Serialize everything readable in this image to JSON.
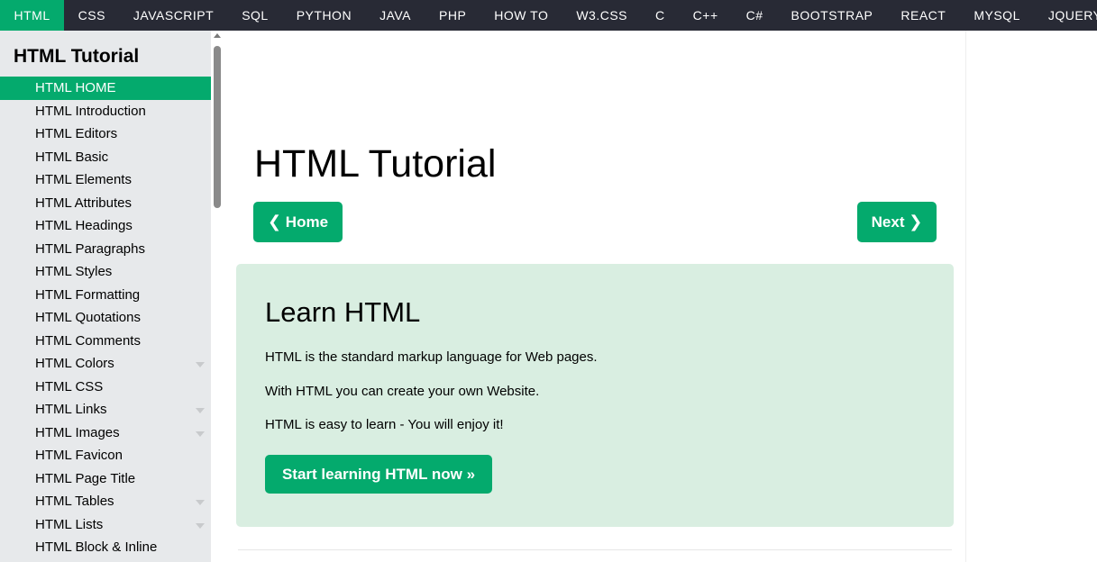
{
  "topnav": {
    "items": [
      "HTML",
      "CSS",
      "JAVASCRIPT",
      "SQL",
      "PYTHON",
      "JAVA",
      "PHP",
      "HOW TO",
      "W3.CSS",
      "C",
      "C++",
      "C#",
      "BOOTSTRAP",
      "REACT",
      "MYSQL",
      "JQUERY"
    ],
    "active": "HTML"
  },
  "sidebar": {
    "title": "HTML Tutorial",
    "items": [
      {
        "label": "HTML HOME",
        "active": true,
        "caret": false
      },
      {
        "label": "HTML Introduction",
        "caret": false
      },
      {
        "label": "HTML Editors",
        "caret": false
      },
      {
        "label": "HTML Basic",
        "caret": false
      },
      {
        "label": "HTML Elements",
        "caret": false
      },
      {
        "label": "HTML Attributes",
        "caret": false
      },
      {
        "label": "HTML Headings",
        "caret": false
      },
      {
        "label": "HTML Paragraphs",
        "caret": false
      },
      {
        "label": "HTML Styles",
        "caret": false
      },
      {
        "label": "HTML Formatting",
        "caret": false
      },
      {
        "label": "HTML Quotations",
        "caret": false
      },
      {
        "label": "HTML Comments",
        "caret": false
      },
      {
        "label": "HTML Colors",
        "caret": true
      },
      {
        "label": "HTML CSS",
        "caret": false
      },
      {
        "label": "HTML Links",
        "caret": true
      },
      {
        "label": "HTML Images",
        "caret": true
      },
      {
        "label": "HTML Favicon",
        "caret": false
      },
      {
        "label": "HTML Page Title",
        "caret": false
      },
      {
        "label": "HTML Tables",
        "caret": true
      },
      {
        "label": "HTML Lists",
        "caret": true
      },
      {
        "label": "HTML Block & Inline",
        "caret": false
      }
    ]
  },
  "main": {
    "title": "HTML Tutorial",
    "home_button": "Home",
    "next_button": "Next",
    "learn": {
      "title": "Learn HTML",
      "p1": "HTML is the standard markup language for Web pages.",
      "p2": "With HTML you can create your own Website.",
      "p3": "HTML is easy to learn - You will enjoy it!",
      "button": "Start learning HTML now »"
    }
  },
  "colors": {
    "accent": "#04aa6d",
    "topnav_bg": "#282a35",
    "sidebar_bg": "#e7e9eb",
    "learn_bg": "#d9eee1"
  }
}
